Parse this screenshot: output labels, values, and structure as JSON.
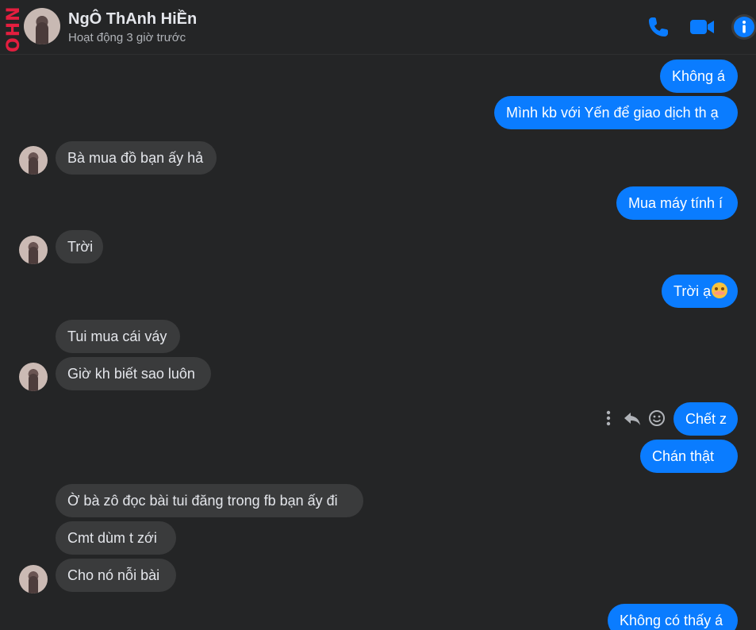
{
  "header": {
    "logo_text": "OHN",
    "contact_name": "NgÔ ThAnh HiỀn",
    "status": "Hoạt động 3 giờ trước",
    "icons": [
      "phone-icon",
      "video-camera-icon",
      "info-icon"
    ]
  },
  "messages": [
    {
      "id": "m1",
      "direction": "out",
      "text": "Không á"
    },
    {
      "id": "m2",
      "direction": "out",
      "text": "Mình kb với Yến để giao dịch th ạ"
    },
    {
      "id": "m3",
      "direction": "in",
      "text": "Bà mua đồ bạn ấy hả"
    },
    {
      "id": "m4",
      "direction": "out",
      "text": "Mua máy tính í"
    },
    {
      "id": "m5",
      "direction": "in",
      "text": "Trời"
    },
    {
      "id": "m6",
      "direction": "out",
      "text": "Trời ạ",
      "emoji": "flushed-face-emoji"
    },
    {
      "id": "m7",
      "direction": "in",
      "text": "Tui mua cái váy"
    },
    {
      "id": "m8",
      "direction": "in",
      "text": "Giờ kh biết sao luôn"
    },
    {
      "id": "m9",
      "direction": "out",
      "text": "Chết z"
    },
    {
      "id": "m10",
      "direction": "out",
      "text": "Chán thật"
    },
    {
      "id": "m11",
      "direction": "in",
      "text": "Ờ bà zô đọc bài tui đăng trong fb bạn ấy đi"
    },
    {
      "id": "m12",
      "direction": "in",
      "text": "Cmt dùm t zới"
    },
    {
      "id": "m13",
      "direction": "in",
      "text": "Cho nó nỗi bài"
    },
    {
      "id": "m14",
      "direction": "out",
      "text": "Không có thấy á"
    }
  ],
  "hover_actions": [
    "more-options-icon",
    "reply-icon",
    "react-icon"
  ],
  "colors": {
    "background": "#242526",
    "outgoing_bubble": "#0a7cff",
    "incoming_bubble": "#3a3b3c",
    "accent": "#0a7cff",
    "logo": "#e41e3f"
  }
}
